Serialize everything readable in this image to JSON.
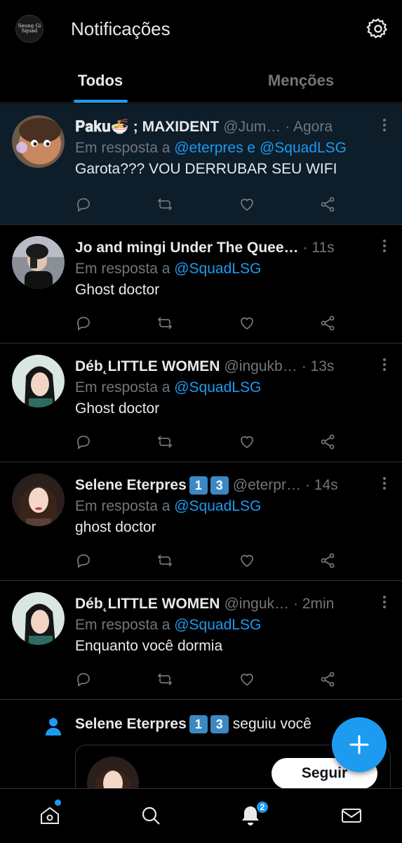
{
  "header": {
    "logo_text": "Seung Gi Squad",
    "title": "Notificações"
  },
  "tabs": [
    {
      "label": "Todos",
      "active": true
    },
    {
      "label": "Menções",
      "active": false
    }
  ],
  "tweets": [
    {
      "name": "𝐏𝐚𝐤𝐮🍜 ; MAXIDENT",
      "handle": "@Jum…",
      "time": "· Agora",
      "reply_prefix": "Em resposta a ",
      "reply_mentions": "@eterpres e @SquadLSG",
      "text": "Garota??? VOU DERRUBAR SEU WIFI"
    },
    {
      "name": "Jo and mingi Under The Quee…",
      "handle": "",
      "time": "· 11s",
      "reply_prefix": "Em resposta a ",
      "reply_mentions": "@SquadLSG",
      "text": "Ghost doctor"
    },
    {
      "name": "Déb˛LITTLE WOMEN",
      "handle": "@ingukb…",
      "time": "· 13s",
      "reply_prefix": "Em resposta a ",
      "reply_mentions": "@SquadLSG",
      "text": "Ghost doctor"
    },
    {
      "name": "Selene Eterpres",
      "badges": [
        "1",
        "3"
      ],
      "handle": "@eterpr…",
      "time": "· 14s",
      "reply_prefix": "Em resposta a ",
      "reply_mentions": "@SquadLSG",
      "text": "ghost doctor"
    },
    {
      "name": "Déb˛LITTLE WOMEN",
      "handle": "@inguk…",
      "time": "· 2min",
      "reply_prefix": "Em resposta a ",
      "reply_mentions": "@SquadLSG",
      "text": "Enquanto você dormia"
    }
  ],
  "follow": {
    "name": "Selene Eterpres",
    "badges": [
      "1",
      "3"
    ],
    "rest": "seguiu você",
    "button_label": "Seguir"
  },
  "bottom_nav": {
    "home_icon": "home-icon",
    "search_icon": "search-icon",
    "bell_icon": "bell-icon",
    "notifications_badge": "2",
    "mail_icon": "mail-icon"
  },
  "colors": {
    "accent": "#1d9bf0",
    "background": "#000000",
    "highlight_row": "#0d1d2a",
    "muted_text": "#71767b"
  }
}
